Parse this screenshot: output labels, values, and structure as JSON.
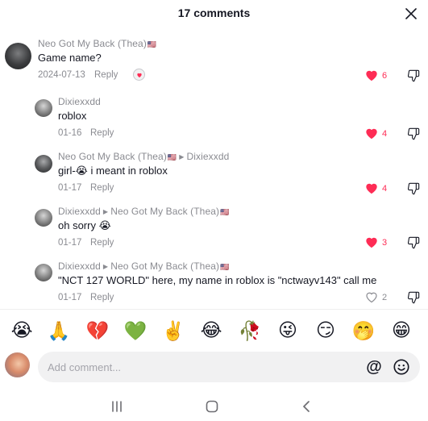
{
  "header": {
    "title": "17 comments"
  },
  "comments": [
    {
      "username": "Neo Got My Back (Thea)",
      "flag": "🇺🇸",
      "reply_to": "",
      "text": "Game name?",
      "date": "2024-07-13",
      "reply_label": "Reply",
      "likes": "6",
      "liked": true
    },
    {
      "username": "Dixiexxdd",
      "flag": "",
      "reply_to": "",
      "text": "roblox",
      "date": "01-16",
      "reply_label": "Reply",
      "likes": "4",
      "liked": true
    },
    {
      "username": "Neo Got My Back (Thea)",
      "flag": "🇺🇸",
      "reply_to": "Dixiexxdd",
      "text": "girl-😭 i meant in roblox",
      "date": "01-17",
      "reply_label": "Reply",
      "likes": "4",
      "liked": true
    },
    {
      "username": "Dixiexxdd",
      "flag": "",
      "reply_to": "Neo Got My Back (Thea)",
      "reply_to_flag": "🇺🇸",
      "text": "oh sorry 😭",
      "date": "01-17",
      "reply_label": "Reply",
      "likes": "3",
      "liked": true
    },
    {
      "username": "Dixiexxdd",
      "flag": "",
      "reply_to": "Neo Got My Back (Thea)",
      "reply_to_flag": "🇺🇸",
      "text": "\"NCT 127 WORLD\" here, my name in roblox is \"nctwayv143\" call me",
      "date": "01-17",
      "reply_label": "Reply",
      "likes": "2",
      "liked": false
    }
  ],
  "emoji_bar": [
    "😭",
    "🙏",
    "💔",
    "💚",
    "✌️",
    "😂",
    "🥀",
    "😜",
    "😏",
    "🤭",
    "😁"
  ],
  "composer": {
    "placeholder": "Add comment...",
    "at_symbol": "@"
  },
  "colors": {
    "accent_like": "#fe2c55",
    "muted_text": "#8a8b91",
    "composer_bg": "#f1f1f2"
  },
  "icons": {
    "close": "close-icon",
    "like": "heart-icon",
    "dislike": "thumbs-down-icon",
    "emoji": "smiley-icon",
    "nav": [
      "recents-icon",
      "home-icon",
      "back-icon"
    ]
  }
}
